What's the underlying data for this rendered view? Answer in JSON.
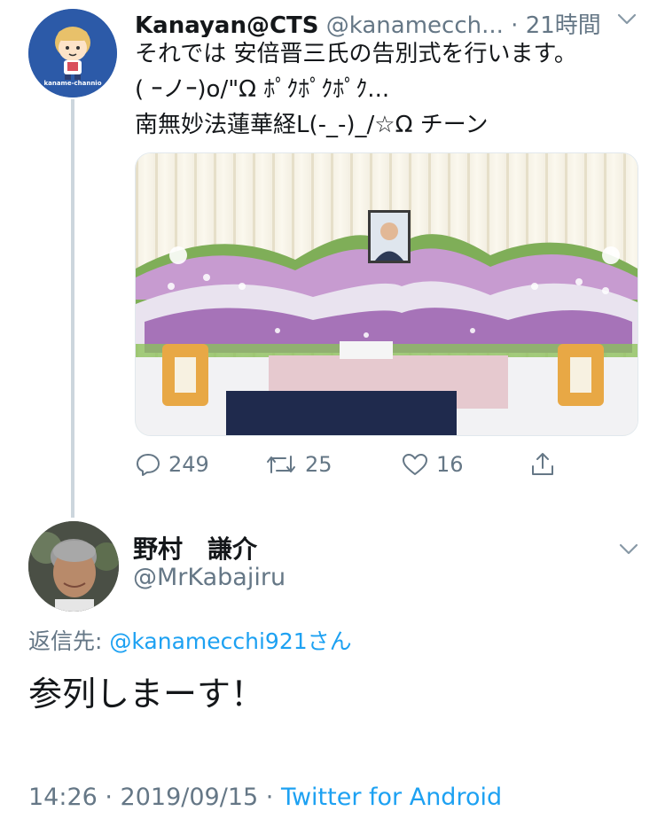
{
  "parent_tweet": {
    "display_name": "Kanayan@CTS",
    "handle": "@kanamecch...",
    "dot": "·",
    "time": "21時間",
    "avatar_caption": "kaname-channio",
    "text_lines": [
      "それでは 安倍晋三氏の告別式を行います。",
      "( ｰノｰ)o/\"Ω ﾎﾟｸﾎﾟｸﾎﾟｸ...",
      "南無妙法蓮華経L(-_-)_/☆Ω チーン"
    ],
    "photo_icon": "funeral-altar-photo",
    "stats": {
      "replies": "249",
      "retweets": "25",
      "likes": "16"
    }
  },
  "reply_tweet": {
    "display_name": "野村　謙介",
    "handle": "@MrKabajiru",
    "reply_to_label": "返信先: ",
    "reply_to_mention": "@kanamecchi921さん",
    "text": "参列しまーす！",
    "timestamp": "14:26 · 2019/09/15 · ",
    "source": "Twitter for Android"
  },
  "colors": {
    "link": "#1da1f2",
    "secondary": "#657786",
    "primary": "#14171a"
  }
}
